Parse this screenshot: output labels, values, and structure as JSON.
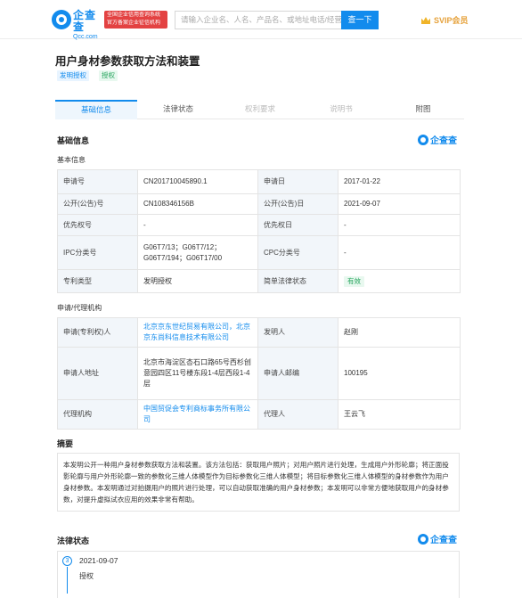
{
  "header": {
    "logo_cn": "企查查",
    "logo_en": "Qcc.com",
    "badge_line1": "全国企业信用查询系统",
    "badge_line2": "官方备案企业征信机构",
    "search_placeholder": "请输入企业名、人名、产品名、或地址电话/经营",
    "search_button": "查一下",
    "svip_label": "SVIP会员"
  },
  "page": {
    "title": "用户身材参数获取方法和装置",
    "tags": [
      "发明授权",
      "授权"
    ]
  },
  "tabs": [
    {
      "label": "基础信息",
      "state": "active"
    },
    {
      "label": "法律状态",
      "state": "normal"
    },
    {
      "label": "权利要求",
      "state": "disabled"
    },
    {
      "label": "说明书",
      "state": "disabled"
    },
    {
      "label": "附图",
      "state": "normal"
    }
  ],
  "basic": {
    "section_title": "基础信息",
    "brand_mark": "企查查",
    "sub_title": "基本信息",
    "rows": [
      {
        "l1": "申请号",
        "v1": "CN201710045890.1",
        "l2": "申请日",
        "v2": "2017-01-22"
      },
      {
        "l1": "公开(公告)号",
        "v1": "CN108346156B",
        "l2": "公开(公告)日",
        "v2": "2021-09-07"
      },
      {
        "l1": "优先权号",
        "v1": "-",
        "l2": "优先权日",
        "v2": "-"
      },
      {
        "l1": "IPC分类号",
        "v1": "G06T7/13；G06T7/12；G06T7/194；G06T17/00",
        "l2": "CPC分类号",
        "v2": "-"
      },
      {
        "l1": "专利类型",
        "v1": "发明授权",
        "l2": "简单法律状态",
        "v2": "有效"
      }
    ]
  },
  "agency": {
    "sub_title": "申请/代理机构",
    "rows": [
      {
        "l1": "申请(专利权)人",
        "v1": "北京京东世纪贸易有限公司，北京京东尚科信息技术有限公司",
        "l2": "发明人",
        "v2": "赵刚"
      },
      {
        "l1": "申请人地址",
        "v1": "北京市海淀区杏石口路65号西杉创意园四区11号楼东段1-4层西段1-4层",
        "l2": "申请人邮编",
        "v2": "100195"
      },
      {
        "l1": "代理机构",
        "v1": "中国贸促会专利商标事务所有限公司",
        "l2": "代理人",
        "v2": "王云飞"
      }
    ]
  },
  "abstract": {
    "title": "摘要",
    "text": "本发明公开一种用户身材参数获取方法和装置。该方法包括：获取用户照片；对用户照片进行处理，生成用户外形轮廓；将正面投影轮廓与用户外形轮廓一致的参数化三维人体模型作为目标参数化三维人体模型；将目标参数化三维人体模型的身材参数作为用户身材参数。本发明通过对拍摄用户的照片进行处理，可以自动获取准确的用户身材参数；本发明可以非常方便地获取用户的身材参数，对提升虚拟试衣应用的效果非常有帮助。"
  },
  "legal": {
    "title": "法律状态",
    "brand_mark": "企查查",
    "index": "3",
    "date": "2021-09-07",
    "status": "授权"
  }
}
